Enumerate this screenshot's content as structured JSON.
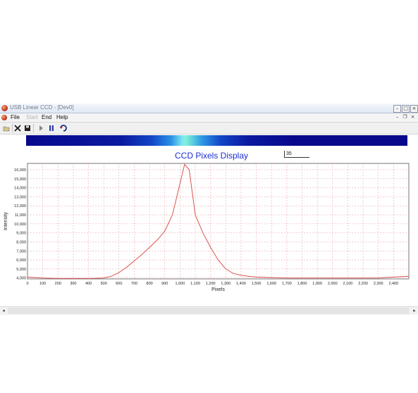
{
  "window": {
    "title": "USB Linear CCD - [Dev0]"
  },
  "menu": {
    "file": "File",
    "disabled_item": "Start",
    "end": "End",
    "help": "Help"
  },
  "toolbar": {
    "icons": [
      "open-icon",
      "close-icon",
      "save-icon",
      "play-icon",
      "pause-icon",
      "refresh-icon"
    ]
  },
  "spectrum_bar": {
    "colors": [
      "#07088c",
      "#1246c6",
      "#7fe8f0",
      "#07088c"
    ]
  },
  "value_box": "35",
  "chart_data": {
    "type": "line",
    "title": "CCD Pixels Display",
    "xlabel": "Pixels",
    "ylabel": "Intensity",
    "xlim": [
      0,
      2500
    ],
    "ylim": [
      3900,
      16700
    ],
    "grid": true,
    "line_color": "#d9534f",
    "x_ticks": [
      "0",
      "100",
      "200",
      "300",
      "400",
      "500",
      "600",
      "700",
      "800",
      "900",
      "1,000",
      "1,100",
      "1,200",
      "1,300",
      "1,400",
      "1,500",
      "1,600",
      "1,700",
      "1,800",
      "1,900",
      "2,000",
      "2,100",
      "2,200",
      "2,300",
      "2,400"
    ],
    "y_ticks": [
      "4,000",
      "5,000",
      "6,000",
      "7,000",
      "8,000",
      "9,000",
      "10,000",
      "11,000",
      "12,000",
      "13,000",
      "14,000",
      "15,000",
      "16,000"
    ],
    "series": [
      {
        "x": [
          0,
          100,
          200,
          300,
          400,
          500,
          550,
          600,
          650,
          700,
          750,
          800,
          850,
          900,
          950,
          1000,
          1030,
          1060,
          1080,
          1100,
          1150,
          1200,
          1250,
          1300,
          1350,
          1400,
          1450,
          1500,
          1600,
          1700,
          1800,
          1900,
          2000,
          2100,
          2200,
          2300,
          2400,
          2500
        ],
        "y": [
          4100,
          4000,
          3950,
          3950,
          3950,
          4000,
          4200,
          4600,
          5200,
          5900,
          6600,
          7400,
          8200,
          9200,
          11000,
          14500,
          16600,
          16000,
          13500,
          11000,
          9000,
          7400,
          6000,
          5000,
          4500,
          4300,
          4200,
          4100,
          4050,
          4000,
          4000,
          4000,
          4000,
          4000,
          4000,
          4000,
          4100,
          4200
        ]
      }
    ]
  }
}
